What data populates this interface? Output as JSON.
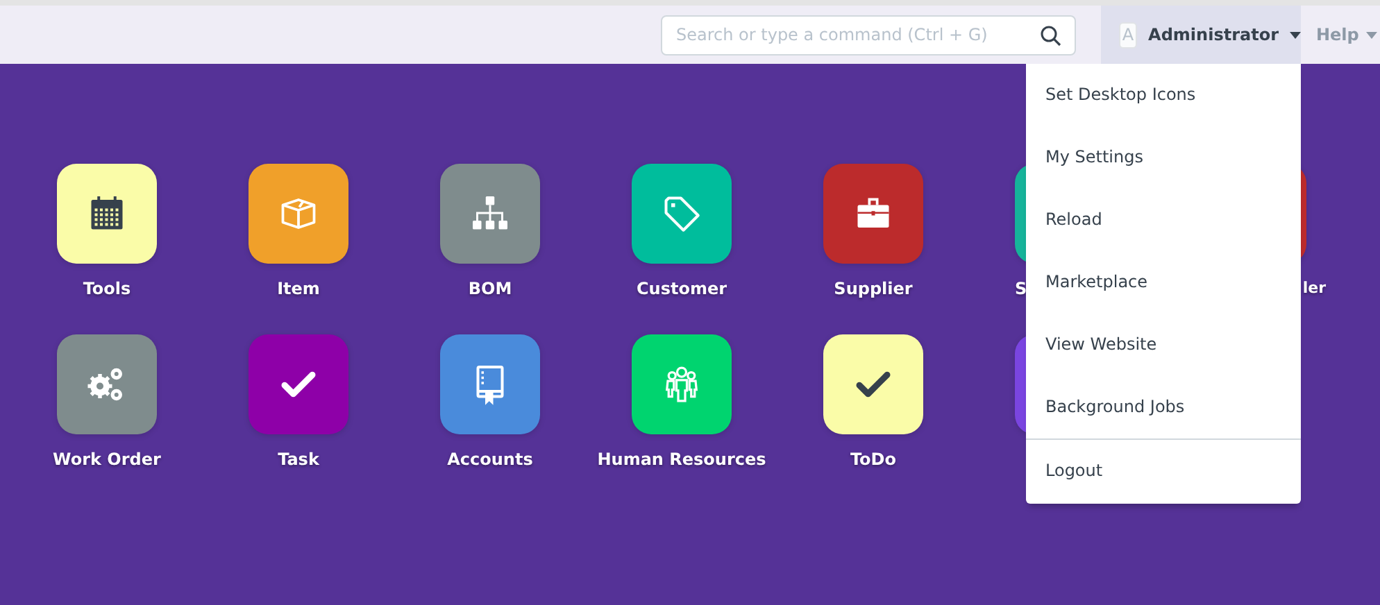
{
  "search": {
    "placeholder": "Search or type a command (Ctrl + G)"
  },
  "user_menu": {
    "avatar": "A",
    "label": "Administrator",
    "expanded": true
  },
  "help_menu": {
    "label": "Help"
  },
  "desktop": {
    "rows": [
      [
        {
          "label": "Tools",
          "color": "#fafca8"
        },
        {
          "label": "Item",
          "color": "#f0a02a"
        },
        {
          "label": "BOM",
          "color": "#7f8c8d"
        },
        {
          "label": "Customer",
          "color": "#00bd9c"
        },
        {
          "label": "Supplier",
          "color": "#bc2b2c"
        },
        {
          "label": "S",
          "color": "#16b39a",
          "kind": "partial_start"
        },
        {
          "label": "ler",
          "color": "#bc2b2c",
          "kind": "partial_end"
        }
      ],
      [
        {
          "label": "Work Order",
          "color": "#7f8c8d"
        },
        {
          "label": "Task",
          "color": "#8e00a8"
        },
        {
          "label": "Accounts",
          "color": "#4a8bdb"
        },
        {
          "label": "Human Resources",
          "color": "#00d46f"
        },
        {
          "label": "ToDo",
          "color": "#fafca8"
        },
        {
          "color": "#7a45e0"
        }
      ]
    ]
  },
  "dropdown": {
    "items": [
      {
        "label": "Set Desktop Icons"
      },
      {
        "label": "My Settings"
      },
      {
        "label": "Reload"
      },
      {
        "label": "Marketplace"
      },
      {
        "label": "View Website"
      },
      {
        "label": "Background Jobs"
      },
      {
        "label": "Logout",
        "divider_before": true
      }
    ]
  }
}
